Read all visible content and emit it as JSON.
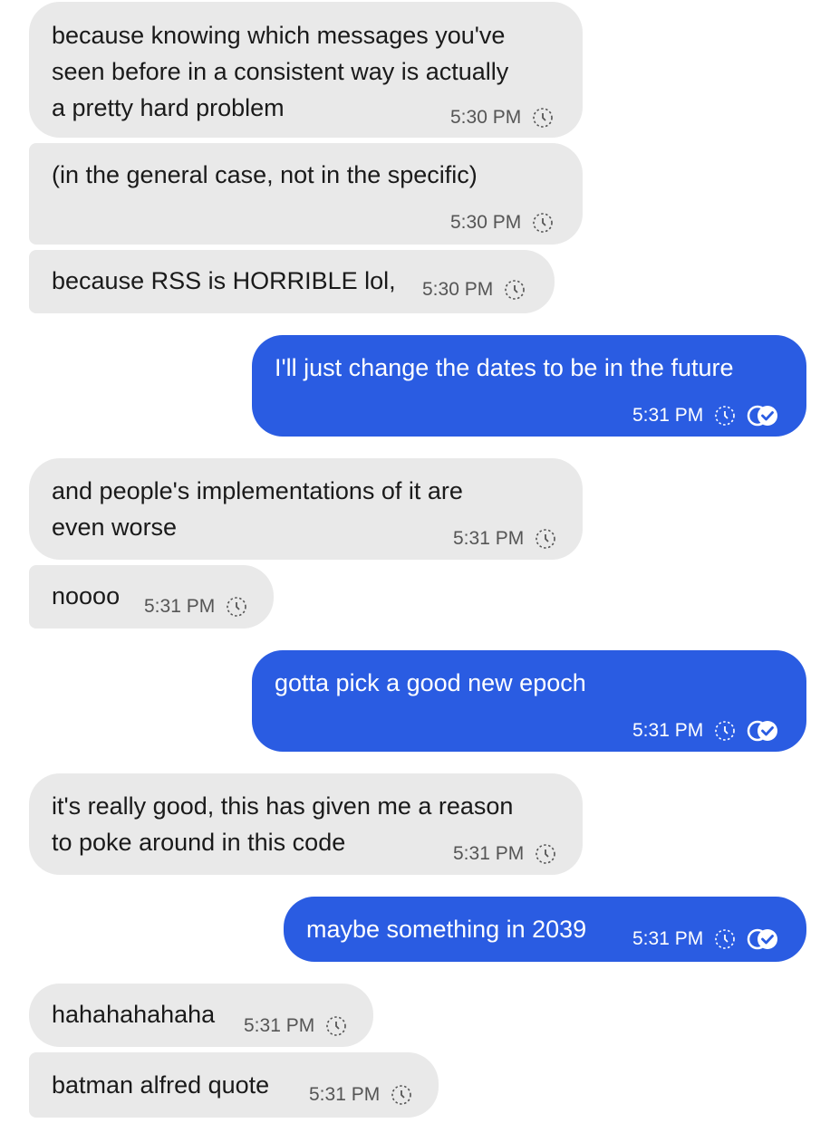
{
  "messages": [
    {
      "dir": "in",
      "lines": [
        "because knowing which messages you've",
        "seen before in a consistent way is actually",
        "a pretty hard problem"
      ],
      "time": "5:30 PM"
    },
    {
      "dir": "in",
      "lines": [
        "(in the general case, not in the specific)"
      ],
      "time": "5:30 PM"
    },
    {
      "dir": "in",
      "lines": [
        "because RSS is HORRIBLE lol,"
      ],
      "time": "5:30 PM"
    },
    {
      "dir": "out",
      "lines": [
        "I'll just change the dates to be in the future"
      ],
      "time": "5:31 PM"
    },
    {
      "dir": "in",
      "lines": [
        "and people's implementations of it are",
        "even worse"
      ],
      "time": "5:31 PM"
    },
    {
      "dir": "in",
      "lines": [
        "noooo"
      ],
      "time": "5:31 PM"
    },
    {
      "dir": "out",
      "lines": [
        "gotta pick a good new epoch"
      ],
      "time": "5:31 PM"
    },
    {
      "dir": "in",
      "lines": [
        "it's really good, this has given me a reason",
        "to poke around in this code"
      ],
      "time": "5:31 PM"
    },
    {
      "dir": "out",
      "lines": [
        "maybe something in 2039"
      ],
      "time": "5:31 PM"
    },
    {
      "dir": "in",
      "lines": [
        "hahahahahaha"
      ],
      "time": "5:31 PM"
    },
    {
      "dir": "in",
      "lines": [
        "batman alfred quote"
      ],
      "time": "5:31 PM"
    }
  ],
  "icons": {
    "pending": "pending-clock-icon",
    "delivered": "delivered-check-icon"
  },
  "colors": {
    "incoming_bg": "#e9e9e9",
    "outgoing_bg": "#2a5ce2"
  }
}
